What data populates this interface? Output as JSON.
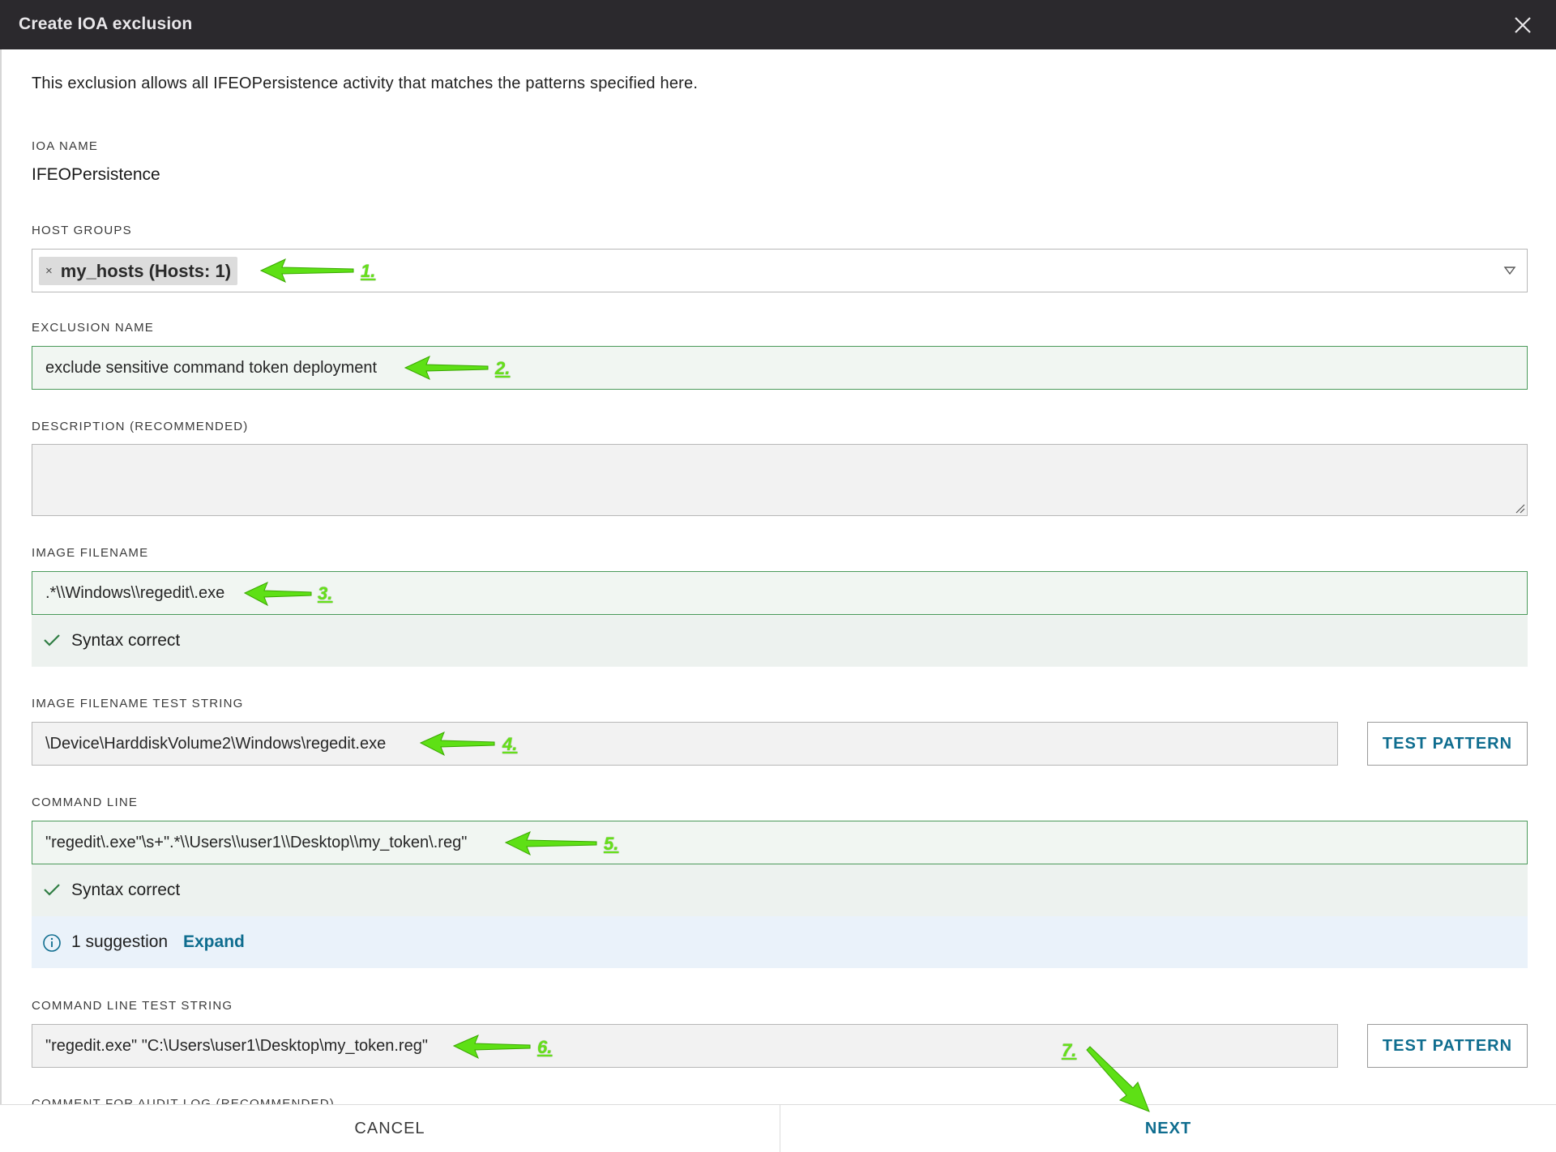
{
  "dialog": {
    "title": "Create IOA exclusion",
    "intro": "This exclusion allows all IFEOPersistence activity that matches the patterns specified here."
  },
  "ioa": {
    "label": "IOA NAME",
    "value": "IFEOPersistence"
  },
  "host_groups": {
    "label": "HOST GROUPS",
    "tag": "my_hosts (Hosts: 1)",
    "tag_remove": "×"
  },
  "exclusion_name": {
    "label": "EXCLUSION NAME",
    "value": "exclude sensitive command token deployment"
  },
  "description": {
    "label": "DESCRIPTION (RECOMMENDED)",
    "value": ""
  },
  "image_filename": {
    "label": "IMAGE FILENAME",
    "value": ".*\\\\Windows\\\\regedit\\.exe",
    "status": "Syntax correct"
  },
  "image_test": {
    "label": "IMAGE FILENAME TEST STRING",
    "value": "\\Device\\HarddiskVolume2\\Windows\\regedit.exe",
    "button": "TEST PATTERN"
  },
  "command_line": {
    "label": "COMMAND LINE",
    "value": "\"regedit\\.exe\"\\s+\".*\\\\Users\\\\user1\\\\Desktop\\\\my_token\\.reg\"",
    "status": "Syntax correct",
    "suggestion": "1 suggestion",
    "expand": "Expand"
  },
  "command_test": {
    "label": "COMMAND LINE TEST STRING",
    "value": "\"regedit.exe\" \"C:\\Users\\user1\\Desktop\\my_token.reg\"",
    "button": "TEST PATTERN"
  },
  "comment": {
    "label": "COMMENT FOR AUDIT LOG (RECOMMENDED)"
  },
  "footer": {
    "cancel": "CANCEL",
    "next": "NEXT"
  },
  "annotations": {
    "color": "#66e01a",
    "steps": [
      "1.",
      "2.",
      "3.",
      "4.",
      "5.",
      "6.",
      "7."
    ]
  },
  "icons": [
    "close-icon",
    "chevron-down-icon",
    "check-icon",
    "info-icon",
    "resize-handle-icon"
  ]
}
